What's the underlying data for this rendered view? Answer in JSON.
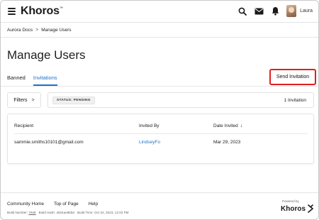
{
  "header": {
    "logo_text": "Khoros",
    "logo_mark": "™",
    "username": "Laura"
  },
  "breadcrumb": {
    "items": [
      "Aurora Docs",
      "Manage Users"
    ],
    "separator": ">"
  },
  "page": {
    "title": "Manage Users"
  },
  "tabs": [
    {
      "label": "Banned",
      "active": false
    },
    {
      "label": "Invitations",
      "active": true
    }
  ],
  "actions": {
    "send_invitation": "Send Invitation"
  },
  "filters": {
    "label": "Filters",
    "chevron": ">",
    "status_chip": "STATUS: PENDING",
    "count": "1 Invitation"
  },
  "table": {
    "columns": [
      "Recipient",
      "Invited By",
      "Date Invited"
    ],
    "sort_arrow": "↓",
    "rows": [
      {
        "recipient": "sammie.smiths10101@gmail.com",
        "invited_by": "LindseyFo",
        "date_invited": "Mar 29, 2023"
      }
    ]
  },
  "footer": {
    "links": [
      "Community Home",
      "Top of Page",
      "Help"
    ],
    "build_number_label": "Build Number:",
    "build_number": "7946",
    "build_hash": "Build Hash: 4624ae8bbd",
    "build_time": "Build Time: Oct 24, 2023, 12:03 PM",
    "powered_by": "Powered by",
    "logo_text": "Khoros"
  },
  "colors": {
    "accent": "#1e73c8",
    "highlight_border": "#e02020"
  }
}
